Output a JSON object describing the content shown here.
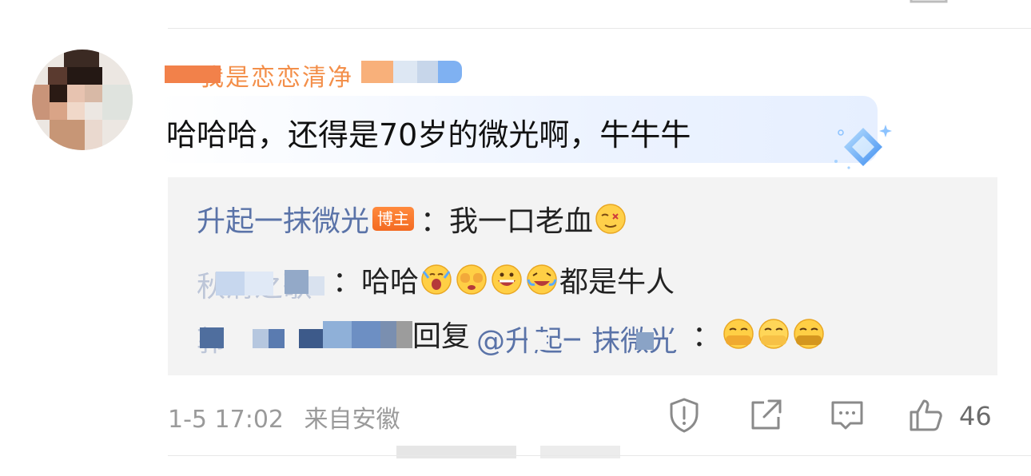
{
  "comment": {
    "username": "我是恋恋清净",
    "text": "哈哈哈，还得是70岁的微光啊，牛牛牛",
    "timestamp": "1-5 17:02",
    "location": "来自安徽",
    "like_count": "46"
  },
  "replies": [
    {
      "author": "升起一抹微光",
      "badge": "博主",
      "separator": "：",
      "text": "我一口老血",
      "emojis": [
        "dizzy-face-emoji"
      ]
    },
    {
      "author": "秋清之歌",
      "separator": "：",
      "text_before": "哈哈",
      "emojis": [
        "screaming-emoji",
        "covering-eyes-emoji",
        "grinning-emoji",
        "laughing-tears-emoji"
      ],
      "text_after": "都是牛人"
    },
    {
      "author": "郭",
      "reply_word": "回复",
      "mention": "@升起一抹微光",
      "separator": "：",
      "emojis": [
        "smirk-emoji",
        "smirk-emoji",
        "smirk-emoji"
      ]
    }
  ],
  "actions": {
    "report_icon": "exclamation-shield-icon",
    "share_icon": "share-external-icon",
    "comment_icon": "comment-bubble-icon",
    "like_icon": "thumbs-up-icon"
  },
  "colors": {
    "username": "#f27c2b",
    "link": "#5a73a8",
    "badge": "#f36a22",
    "reply_bg": "#f3f3f3",
    "meta": "#9a9a9a"
  }
}
